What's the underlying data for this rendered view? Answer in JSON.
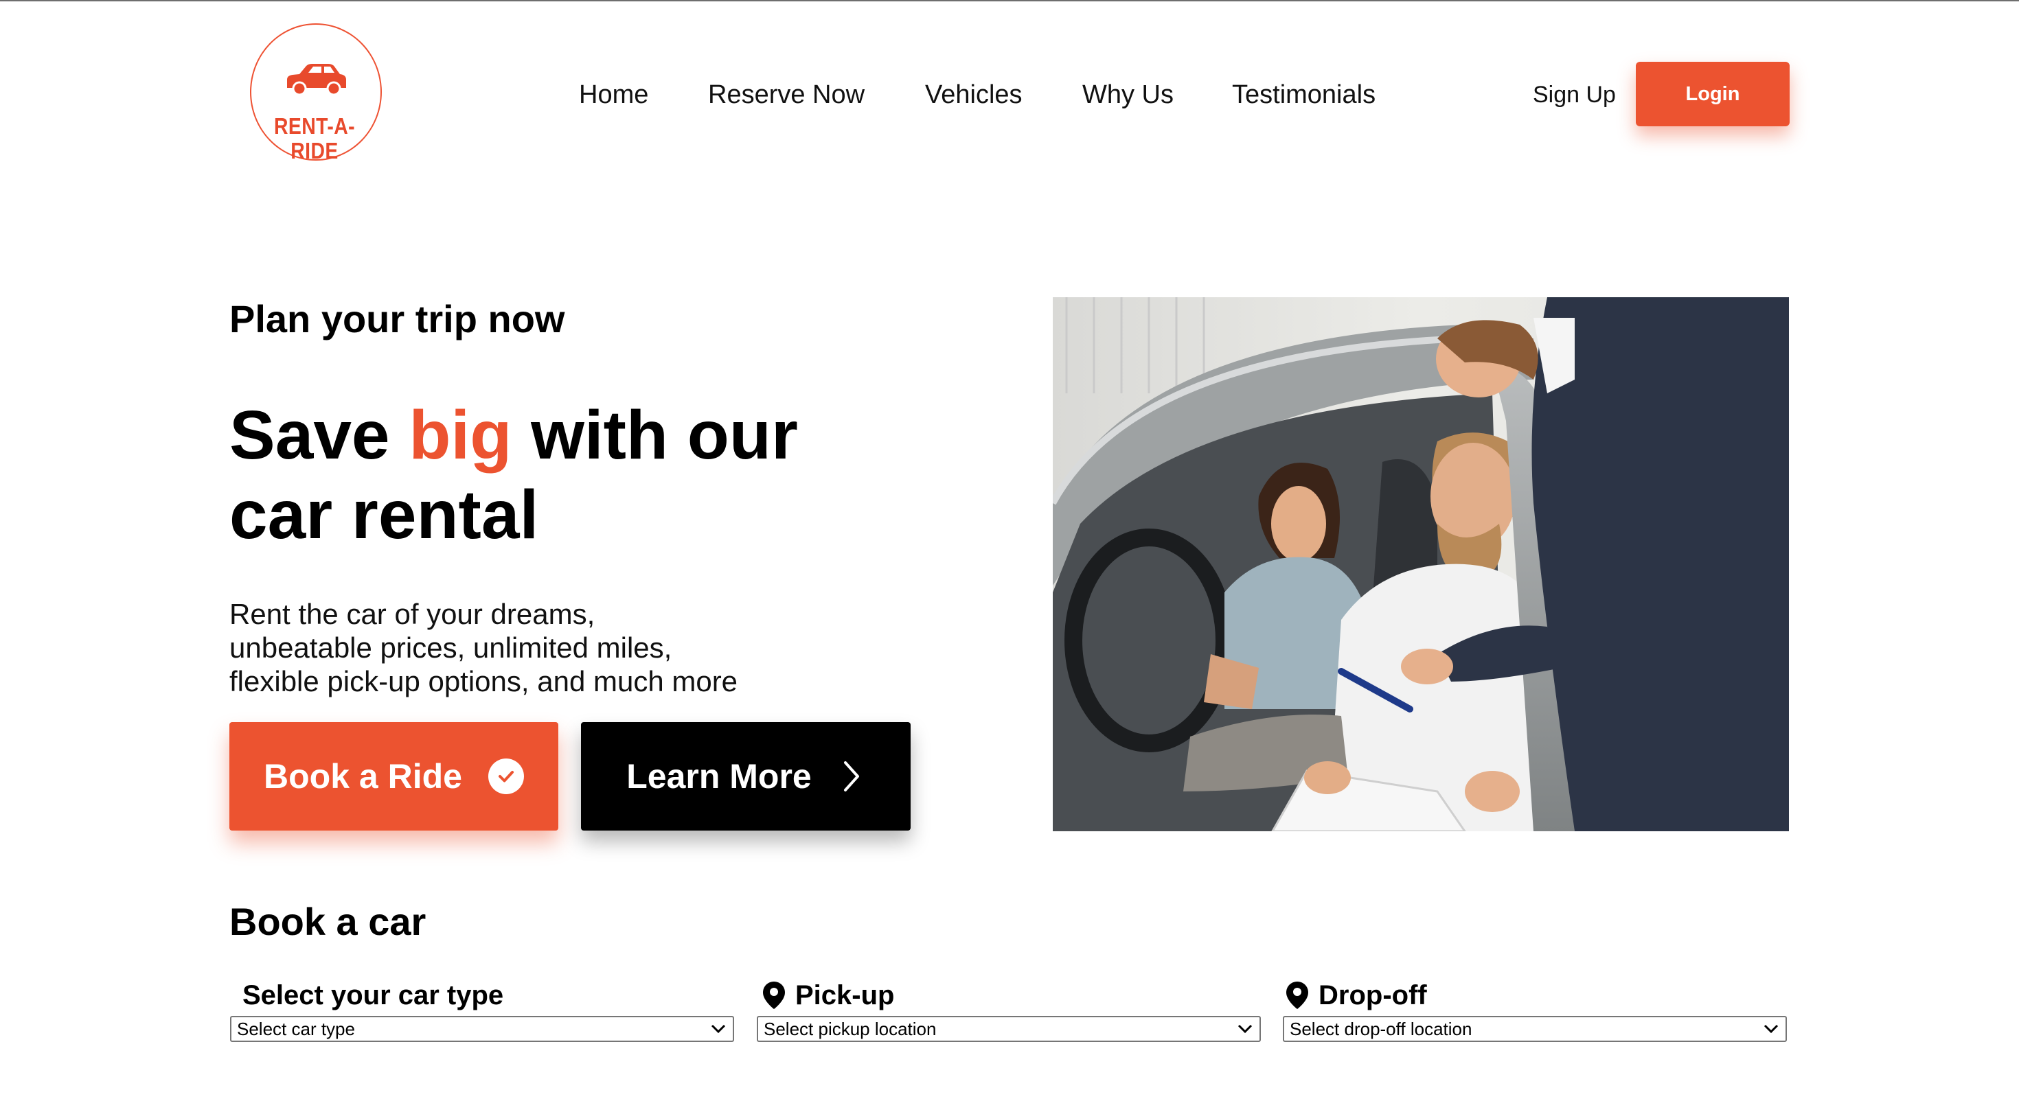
{
  "brand": {
    "name": "RENT-A-RIDE",
    "accent_color": "#ec5330"
  },
  "nav": {
    "items": [
      {
        "label": "Home"
      },
      {
        "label": "Reserve Now"
      },
      {
        "label": "Vehicles"
      },
      {
        "label": "Why Us"
      },
      {
        "label": "Testimonials"
      }
    ],
    "signup_label": "Sign Up",
    "login_label": "Login"
  },
  "hero": {
    "eyebrow": "Plan your trip now",
    "headline_part1": "Save ",
    "headline_accent": "big",
    "headline_part2": " with our car rental",
    "description_lines": [
      "Rent the car of your dreams,",
      "unbeatable prices, unlimited miles,",
      "flexible pick-up options, and much more"
    ],
    "book_button_label": "Book a Ride",
    "book_button_icon": "check-circle-icon",
    "learn_button_label": "Learn More",
    "learn_button_icon": "chevron-right-icon",
    "image_icon": "car-rental-photo"
  },
  "booking": {
    "title": "Book a car",
    "fields": [
      {
        "label": "Select your car type",
        "selected": "Select car type",
        "icon": ""
      },
      {
        "label": "Pick-up",
        "selected": "Select pickup location",
        "icon": "location-pin-icon"
      },
      {
        "label": "Drop-off",
        "selected": "Select drop-off location",
        "icon": "location-pin-icon"
      }
    ]
  }
}
